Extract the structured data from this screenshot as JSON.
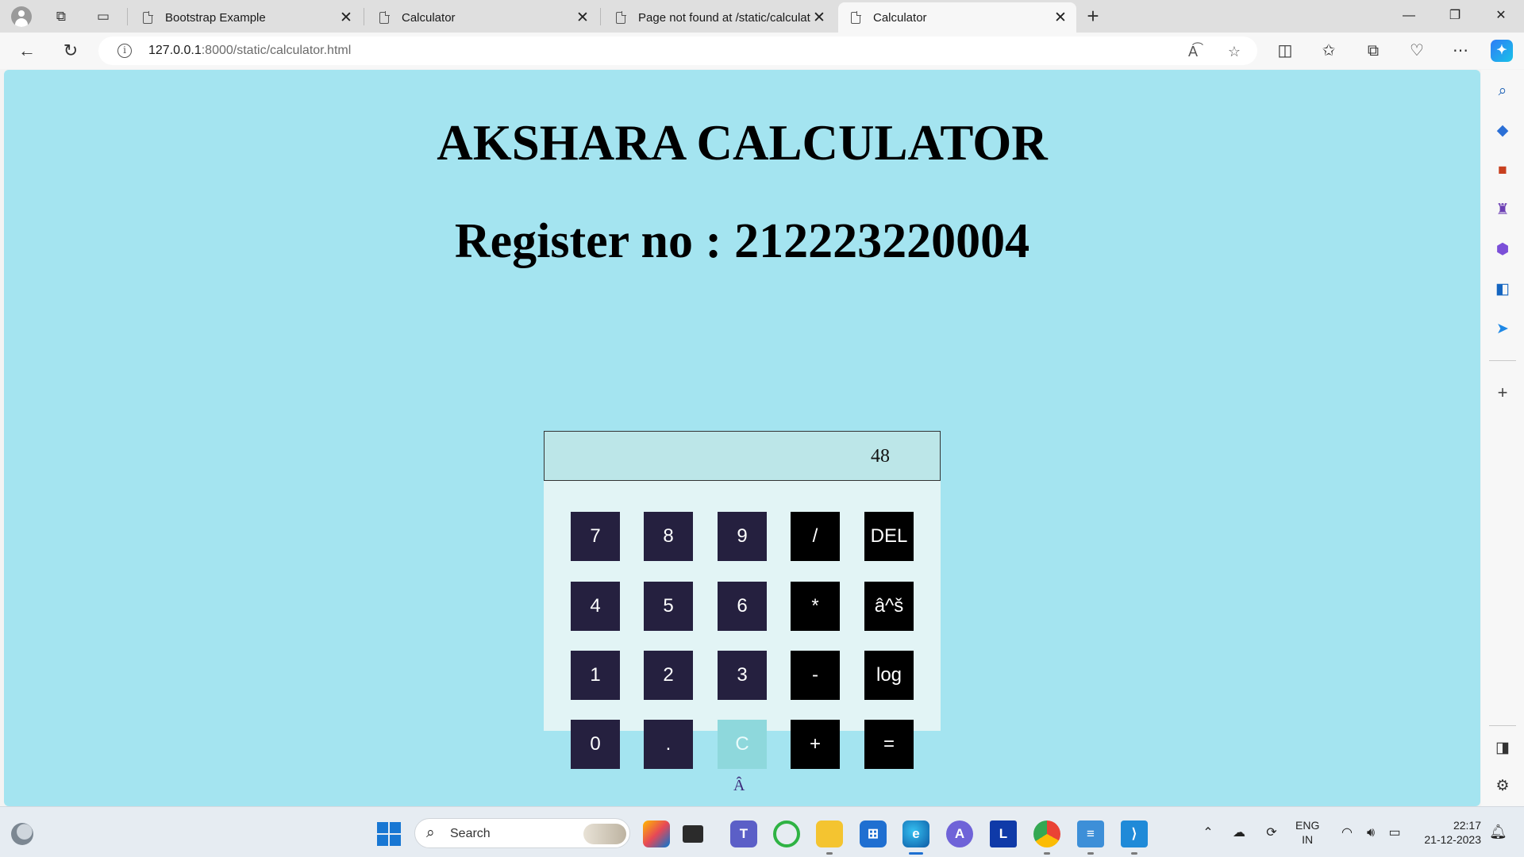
{
  "browser": {
    "tabs": [
      {
        "title": "Bootstrap Example",
        "active": false
      },
      {
        "title": "Calculator",
        "active": false
      },
      {
        "title": "Page not found at /static/calculat",
        "active": false
      },
      {
        "title": "Calculator",
        "active": true
      }
    ],
    "tab_close_glyph": "✕",
    "address": {
      "host": "127.0.0.1",
      "path": ":8000/static/calculator.html"
    }
  },
  "page": {
    "title": "AKSHARA CALCULATOR",
    "register_label": "Register no :",
    "register_number": "212223220004",
    "stray_char": "Â"
  },
  "calculator": {
    "display_value": "48",
    "keys": [
      {
        "label": "7",
        "kind": "num"
      },
      {
        "label": "8",
        "kind": "num"
      },
      {
        "label": "9",
        "kind": "num"
      },
      {
        "label": "/",
        "kind": "op"
      },
      {
        "label": "DEL",
        "kind": "op"
      },
      {
        "label": "4",
        "kind": "num"
      },
      {
        "label": "5",
        "kind": "num"
      },
      {
        "label": "6",
        "kind": "num"
      },
      {
        "label": "*",
        "kind": "op"
      },
      {
        "label": "â^š",
        "kind": "op"
      },
      {
        "label": "1",
        "kind": "num"
      },
      {
        "label": "2",
        "kind": "num"
      },
      {
        "label": "3",
        "kind": "num"
      },
      {
        "label": "-",
        "kind": "op"
      },
      {
        "label": "log",
        "kind": "op"
      },
      {
        "label": "0",
        "kind": "num"
      },
      {
        "label": ".",
        "kind": "num"
      },
      {
        "label": "C",
        "kind": "clear"
      },
      {
        "label": "+",
        "kind": "op"
      },
      {
        "label": "=",
        "kind": "op"
      }
    ]
  },
  "taskbar": {
    "search_placeholder": "Search",
    "language": "ENG",
    "region": "IN",
    "time": "22:17",
    "date": "21-12-2023"
  },
  "colors": {
    "page_background": "#a4e4f0",
    "number_key": "#25203f",
    "operator_key": "#000000",
    "clear_key": "#8ed8dc",
    "display_background": "#bce6e8",
    "calculator_background": "#e2f4f5"
  }
}
